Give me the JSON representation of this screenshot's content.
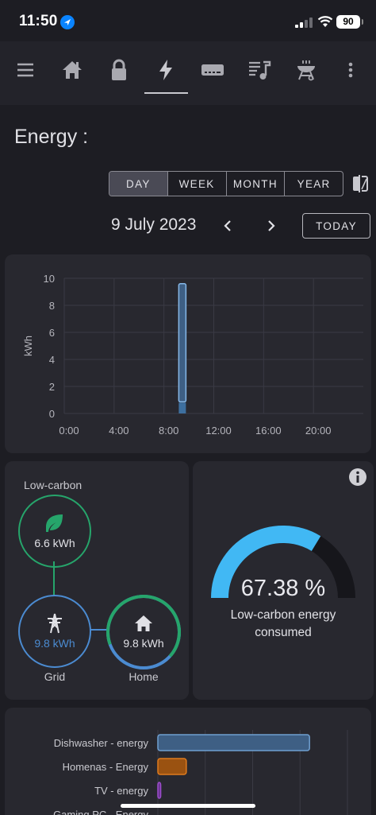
{
  "status_bar": {
    "time": "11:50",
    "battery": "90"
  },
  "nav": {
    "tabs": [
      "menu",
      "home",
      "lock",
      "energy",
      "media-player",
      "music",
      "bbq",
      "more"
    ],
    "active": "energy"
  },
  "page": {
    "title": "Energy :"
  },
  "period": {
    "options": [
      "DAY",
      "WEEK",
      "MONTH",
      "YEAR"
    ],
    "selected": "DAY"
  },
  "date_nav": {
    "date": "9 July 2023",
    "today_label": "TODAY"
  },
  "colors": {
    "accent_blue": "#4b8bd1",
    "green": "#26a56b",
    "gauge": "#41b8f4",
    "orange": "#e07b1d",
    "purple": "#9c4dcc"
  },
  "chart_data": [
    {
      "type": "bar",
      "ylabel": "kWh",
      "yticks": [
        "0",
        "2",
        "4",
        "6",
        "8",
        "10"
      ],
      "xticks": [
        "0:00",
        "4:00",
        "8:00",
        "12:00",
        "16:00",
        "20:00"
      ],
      "ylim": [
        0,
        10
      ],
      "xlim": [
        0,
        24
      ],
      "grid": true,
      "series": [
        {
          "values": [
            {
              "hour": 9,
              "low_carbon": 0.8,
              "rest": 8.8
            }
          ]
        }
      ]
    },
    {
      "type": "bar",
      "orientation": "horizontal",
      "categories": [
        "Dishwasher - energy",
        "Homenas - Energy",
        "TV - energy",
        "Gaming PC - Energy"
      ],
      "values": [
        1.6,
        0.3,
        0.03,
        0
      ],
      "grid": true
    }
  ],
  "sources": {
    "low_carbon_label": "Low-carbon",
    "low_carbon_value": "6.6 kWh",
    "grid_label": "Grid",
    "grid_value": "9.8 kWh",
    "home_label": "Home",
    "home_value": "9.8 kWh"
  },
  "gauge": {
    "value": "67.38 %",
    "fraction": 0.6738,
    "caption_line1": "Low-carbon energy",
    "caption_line2": "consumed"
  }
}
